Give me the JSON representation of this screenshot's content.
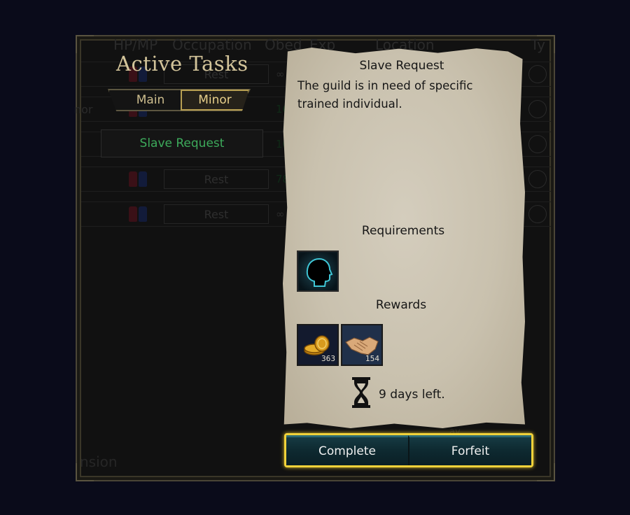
{
  "background": {
    "columns": [
      "HP/MP",
      "Occupation",
      "Obed",
      "Exp",
      "Location",
      "Ty"
    ],
    "rows": [
      {
        "button": "Rest",
        "value": "∞"
      },
      {
        "button": "",
        "value": "16",
        "side_text": "nor"
      },
      {
        "button": "",
        "value": "10"
      },
      {
        "button": "Rest",
        "value": "78"
      },
      {
        "button": "Rest",
        "value": "∞"
      }
    ],
    "footer_left": "nsion",
    "footer_right": "ay"
  },
  "panel": {
    "title": "Active Tasks",
    "tabs": [
      {
        "label": "Main",
        "selected": false
      },
      {
        "label": "Minor",
        "selected": true
      }
    ],
    "task_list": [
      {
        "label": "Slave Request",
        "color": "#3daa5b"
      }
    ]
  },
  "quest": {
    "title": "Slave Request",
    "description": "The guild is in need of specific trained individual.",
    "requirements_heading": "Requirements",
    "requirements": [
      {
        "icon": "silhouette-head-icon"
      }
    ],
    "rewards_heading": "Rewards",
    "rewards": [
      {
        "icon": "gold-coins-icon",
        "amount": "363"
      },
      {
        "icon": "handshake-icon",
        "amount": "154"
      }
    ],
    "time_icon": "hourglass-icon",
    "days_left": "9 days left."
  },
  "actions": {
    "complete_label": "Complete",
    "forfeit_label": "Forfeit",
    "highlight_color": "#f1d23a"
  }
}
